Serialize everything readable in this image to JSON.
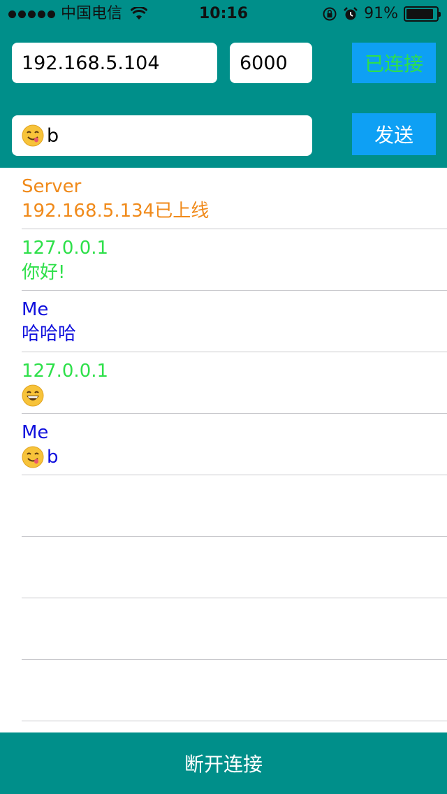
{
  "status_bar": {
    "carrier": "中国电信",
    "time": "10:16",
    "battery": "91%",
    "battery_level": 0.91
  },
  "connection": {
    "ip_value": "192.168.5.104",
    "port_value": "6000",
    "connect_label": "已连接"
  },
  "composer": {
    "message_text": "b",
    "message_emoji": "yum-face-icon",
    "send_label": "发送"
  },
  "colors": {
    "header_bg": "#008f8a",
    "button_bg": "#0ea0f4",
    "server_text": "#f08a1a",
    "peer_text": "#2ee04a",
    "me_text": "#1010dd"
  },
  "messages": [
    {
      "sender": "Server",
      "text": "192.168.5.134已上线",
      "emoji": ""
    },
    {
      "sender": "127.0.0.1",
      "text": "你好!",
      "emoji": ""
    },
    {
      "sender": "Me",
      "text": "哈哈哈",
      "emoji": ""
    },
    {
      "sender": "127.0.0.1",
      "text": "",
      "emoji": "grin-face-icon"
    },
    {
      "sender": "Me",
      "text": "b",
      "emoji": "yum-face-icon"
    }
  ],
  "footer": {
    "disconnect_label": "断开连接"
  }
}
